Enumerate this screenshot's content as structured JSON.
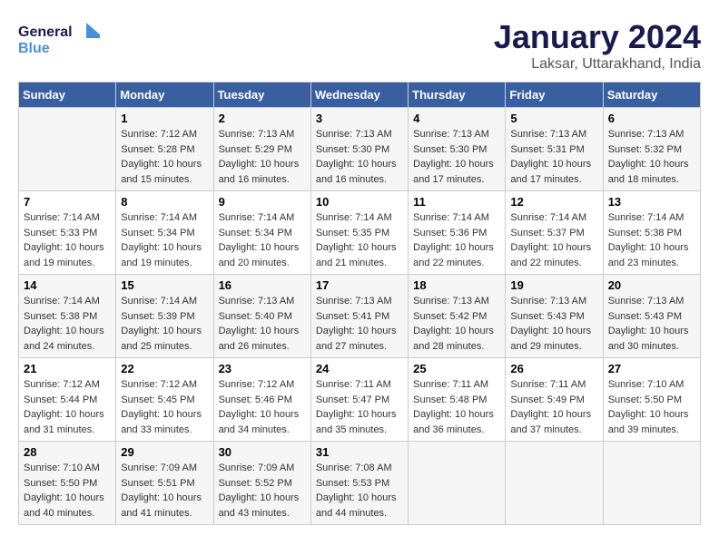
{
  "logo": {
    "text_general": "General",
    "text_blue": "Blue"
  },
  "header": {
    "title": "January 2024",
    "location": "Laksar, Uttarakhand, India"
  },
  "weekdays": [
    "Sunday",
    "Monday",
    "Tuesday",
    "Wednesday",
    "Thursday",
    "Friday",
    "Saturday"
  ],
  "weeks": [
    [
      {
        "day": "",
        "info": ""
      },
      {
        "day": "1",
        "info": "Sunrise: 7:12 AM\nSunset: 5:28 PM\nDaylight: 10 hours\nand 15 minutes."
      },
      {
        "day": "2",
        "info": "Sunrise: 7:13 AM\nSunset: 5:29 PM\nDaylight: 10 hours\nand 16 minutes."
      },
      {
        "day": "3",
        "info": "Sunrise: 7:13 AM\nSunset: 5:30 PM\nDaylight: 10 hours\nand 16 minutes."
      },
      {
        "day": "4",
        "info": "Sunrise: 7:13 AM\nSunset: 5:30 PM\nDaylight: 10 hours\nand 17 minutes."
      },
      {
        "day": "5",
        "info": "Sunrise: 7:13 AM\nSunset: 5:31 PM\nDaylight: 10 hours\nand 17 minutes."
      },
      {
        "day": "6",
        "info": "Sunrise: 7:13 AM\nSunset: 5:32 PM\nDaylight: 10 hours\nand 18 minutes."
      }
    ],
    [
      {
        "day": "7",
        "info": "Sunrise: 7:14 AM\nSunset: 5:33 PM\nDaylight: 10 hours\nand 19 minutes."
      },
      {
        "day": "8",
        "info": "Sunrise: 7:14 AM\nSunset: 5:34 PM\nDaylight: 10 hours\nand 19 minutes."
      },
      {
        "day": "9",
        "info": "Sunrise: 7:14 AM\nSunset: 5:34 PM\nDaylight: 10 hours\nand 20 minutes."
      },
      {
        "day": "10",
        "info": "Sunrise: 7:14 AM\nSunset: 5:35 PM\nDaylight: 10 hours\nand 21 minutes."
      },
      {
        "day": "11",
        "info": "Sunrise: 7:14 AM\nSunset: 5:36 PM\nDaylight: 10 hours\nand 22 minutes."
      },
      {
        "day": "12",
        "info": "Sunrise: 7:14 AM\nSunset: 5:37 PM\nDaylight: 10 hours\nand 22 minutes."
      },
      {
        "day": "13",
        "info": "Sunrise: 7:14 AM\nSunset: 5:38 PM\nDaylight: 10 hours\nand 23 minutes."
      }
    ],
    [
      {
        "day": "14",
        "info": "Sunrise: 7:14 AM\nSunset: 5:38 PM\nDaylight: 10 hours\nand 24 minutes."
      },
      {
        "day": "15",
        "info": "Sunrise: 7:14 AM\nSunset: 5:39 PM\nDaylight: 10 hours\nand 25 minutes."
      },
      {
        "day": "16",
        "info": "Sunrise: 7:13 AM\nSunset: 5:40 PM\nDaylight: 10 hours\nand 26 minutes."
      },
      {
        "day": "17",
        "info": "Sunrise: 7:13 AM\nSunset: 5:41 PM\nDaylight: 10 hours\nand 27 minutes."
      },
      {
        "day": "18",
        "info": "Sunrise: 7:13 AM\nSunset: 5:42 PM\nDaylight: 10 hours\nand 28 minutes."
      },
      {
        "day": "19",
        "info": "Sunrise: 7:13 AM\nSunset: 5:43 PM\nDaylight: 10 hours\nand 29 minutes."
      },
      {
        "day": "20",
        "info": "Sunrise: 7:13 AM\nSunset: 5:43 PM\nDaylight: 10 hours\nand 30 minutes."
      }
    ],
    [
      {
        "day": "21",
        "info": "Sunrise: 7:12 AM\nSunset: 5:44 PM\nDaylight: 10 hours\nand 31 minutes."
      },
      {
        "day": "22",
        "info": "Sunrise: 7:12 AM\nSunset: 5:45 PM\nDaylight: 10 hours\nand 33 minutes."
      },
      {
        "day": "23",
        "info": "Sunrise: 7:12 AM\nSunset: 5:46 PM\nDaylight: 10 hours\nand 34 minutes."
      },
      {
        "day": "24",
        "info": "Sunrise: 7:11 AM\nSunset: 5:47 PM\nDaylight: 10 hours\nand 35 minutes."
      },
      {
        "day": "25",
        "info": "Sunrise: 7:11 AM\nSunset: 5:48 PM\nDaylight: 10 hours\nand 36 minutes."
      },
      {
        "day": "26",
        "info": "Sunrise: 7:11 AM\nSunset: 5:49 PM\nDaylight: 10 hours\nand 37 minutes."
      },
      {
        "day": "27",
        "info": "Sunrise: 7:10 AM\nSunset: 5:50 PM\nDaylight: 10 hours\nand 39 minutes."
      }
    ],
    [
      {
        "day": "28",
        "info": "Sunrise: 7:10 AM\nSunset: 5:50 PM\nDaylight: 10 hours\nand 40 minutes."
      },
      {
        "day": "29",
        "info": "Sunrise: 7:09 AM\nSunset: 5:51 PM\nDaylight: 10 hours\nand 41 minutes."
      },
      {
        "day": "30",
        "info": "Sunrise: 7:09 AM\nSunset: 5:52 PM\nDaylight: 10 hours\nand 43 minutes."
      },
      {
        "day": "31",
        "info": "Sunrise: 7:08 AM\nSunset: 5:53 PM\nDaylight: 10 hours\nand 44 minutes."
      },
      {
        "day": "",
        "info": ""
      },
      {
        "day": "",
        "info": ""
      },
      {
        "day": "",
        "info": ""
      }
    ]
  ]
}
